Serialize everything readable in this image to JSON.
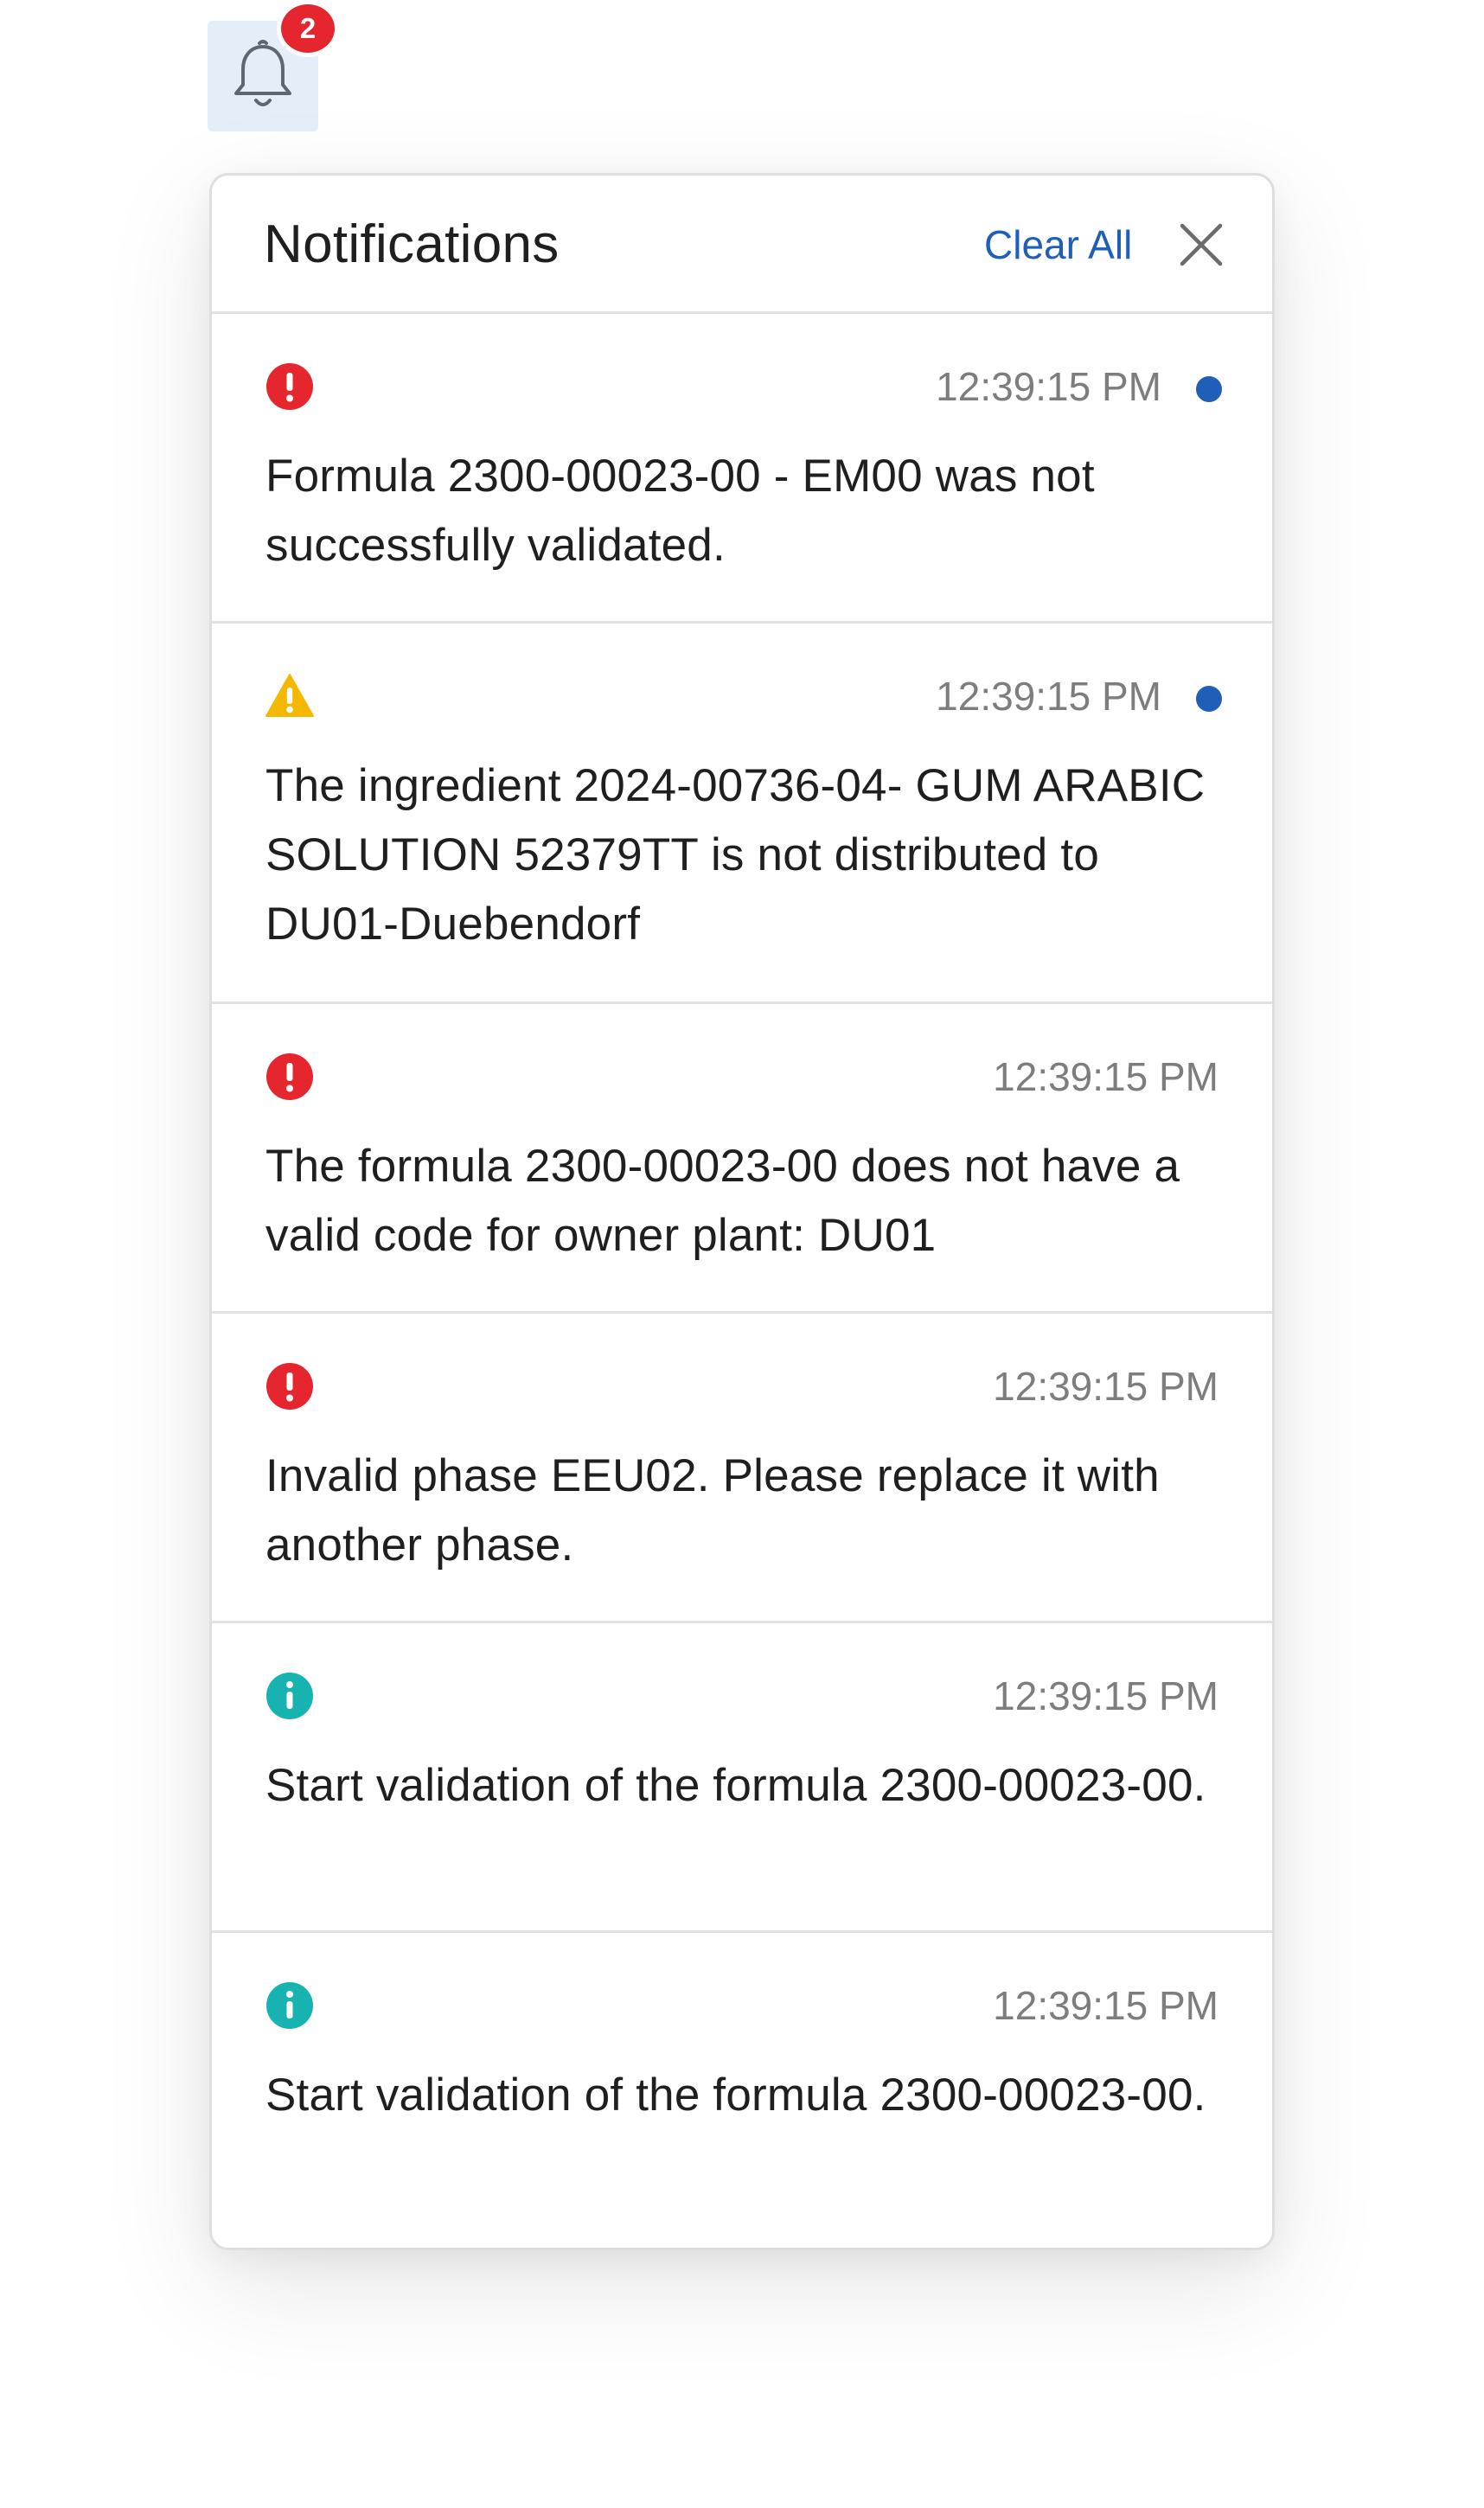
{
  "bell": {
    "icon": "bell-icon",
    "badge_count": "2"
  },
  "panel": {
    "title": "Notifications",
    "clear_all_label": "Clear All",
    "close_icon": "close-icon"
  },
  "colors": {
    "error": "#e5262e",
    "warning": "#f5b800",
    "info": "#17b3b0",
    "accent": "#1f5fb8",
    "unread_dot": "#1f5fb8"
  },
  "notifications": [
    {
      "type": "error",
      "icon": "error-icon",
      "time": "12:39:15 PM",
      "unread": true,
      "message": "Formula 2300-00023-00 - EM00 was not successfully validated."
    },
    {
      "type": "warning",
      "icon": "warning-icon",
      "time": "12:39:15 PM",
      "unread": true,
      "message": "The ingredient 2024-00736-04- GUM ARABIC SOLUTION 52379TT is not distributed to DU01-Duebendorf"
    },
    {
      "type": "error",
      "icon": "error-icon",
      "time": "12:39:15 PM",
      "unread": false,
      "message": "The formula 2300-00023-00 does not have a valid code for owner plant: DU01"
    },
    {
      "type": "error",
      "icon": "error-icon",
      "time": "12:39:15 PM",
      "unread": false,
      "message": "Invalid phase EEU02. Please replace it with another phase."
    },
    {
      "type": "info",
      "icon": "info-icon",
      "time": "12:39:15 PM",
      "unread": false,
      "message": "Start validation of the formula 2300-00023-00."
    },
    {
      "type": "info",
      "icon": "info-icon",
      "time": "12:39:15 PM",
      "unread": false,
      "message": "Start validation of the formula 2300-00023-00."
    }
  ]
}
